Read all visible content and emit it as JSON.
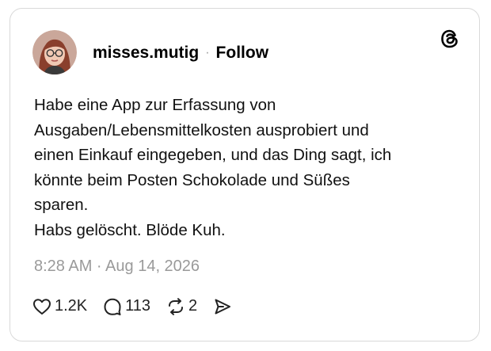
{
  "post": {
    "author": {
      "username": "misses.mutig",
      "separator": "·",
      "follow_label": "Follow"
    },
    "text_lines": [
      "Habe eine App zur Erfassung von",
      "Ausgaben/Lebensmittelkosten ausprobiert und",
      "einen Einkauf eingegeben, und das Ding sagt, ich",
      "könnte beim Posten Schokolade und Süßes",
      "sparen.",
      "Habs gelöscht. Blöde Kuh."
    ],
    "timestamp": "8:28 AM · Aug 14, 2026",
    "actions": {
      "likes": "1.2K",
      "replies": "113",
      "reposts": "2"
    },
    "icons": {
      "brand": "threads-logo-icon",
      "like": "heart-icon",
      "reply": "comment-bubble-icon",
      "repost": "repost-arrows-icon",
      "share": "send-icon"
    }
  }
}
